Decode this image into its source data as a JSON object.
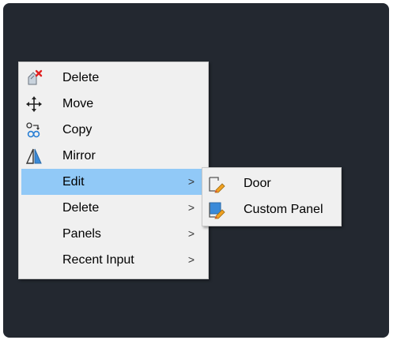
{
  "context_menu": {
    "items": [
      {
        "label": "Delete",
        "icon": "delete-icon"
      },
      {
        "label": "Move",
        "icon": "move-icon"
      },
      {
        "label": "Copy",
        "icon": "copy-icon"
      },
      {
        "label": "Mirror",
        "icon": "mirror-icon"
      },
      {
        "label": "Edit",
        "submenu": true,
        "highlighted": true
      },
      {
        "label": "Delete",
        "submenu": true
      },
      {
        "label": "Panels",
        "submenu": true
      },
      {
        "label": "Recent Input",
        "submenu": true
      }
    ],
    "submenu_arrow": ">"
  },
  "edit_submenu": {
    "items": [
      {
        "label": "Door",
        "icon": "edit-door-icon"
      },
      {
        "label": "Custom Panel",
        "icon": "edit-custom-panel-icon"
      }
    ]
  },
  "colors": {
    "background": "#232830",
    "menu": "#f0f0f0",
    "highlight": "#91c9f7"
  }
}
